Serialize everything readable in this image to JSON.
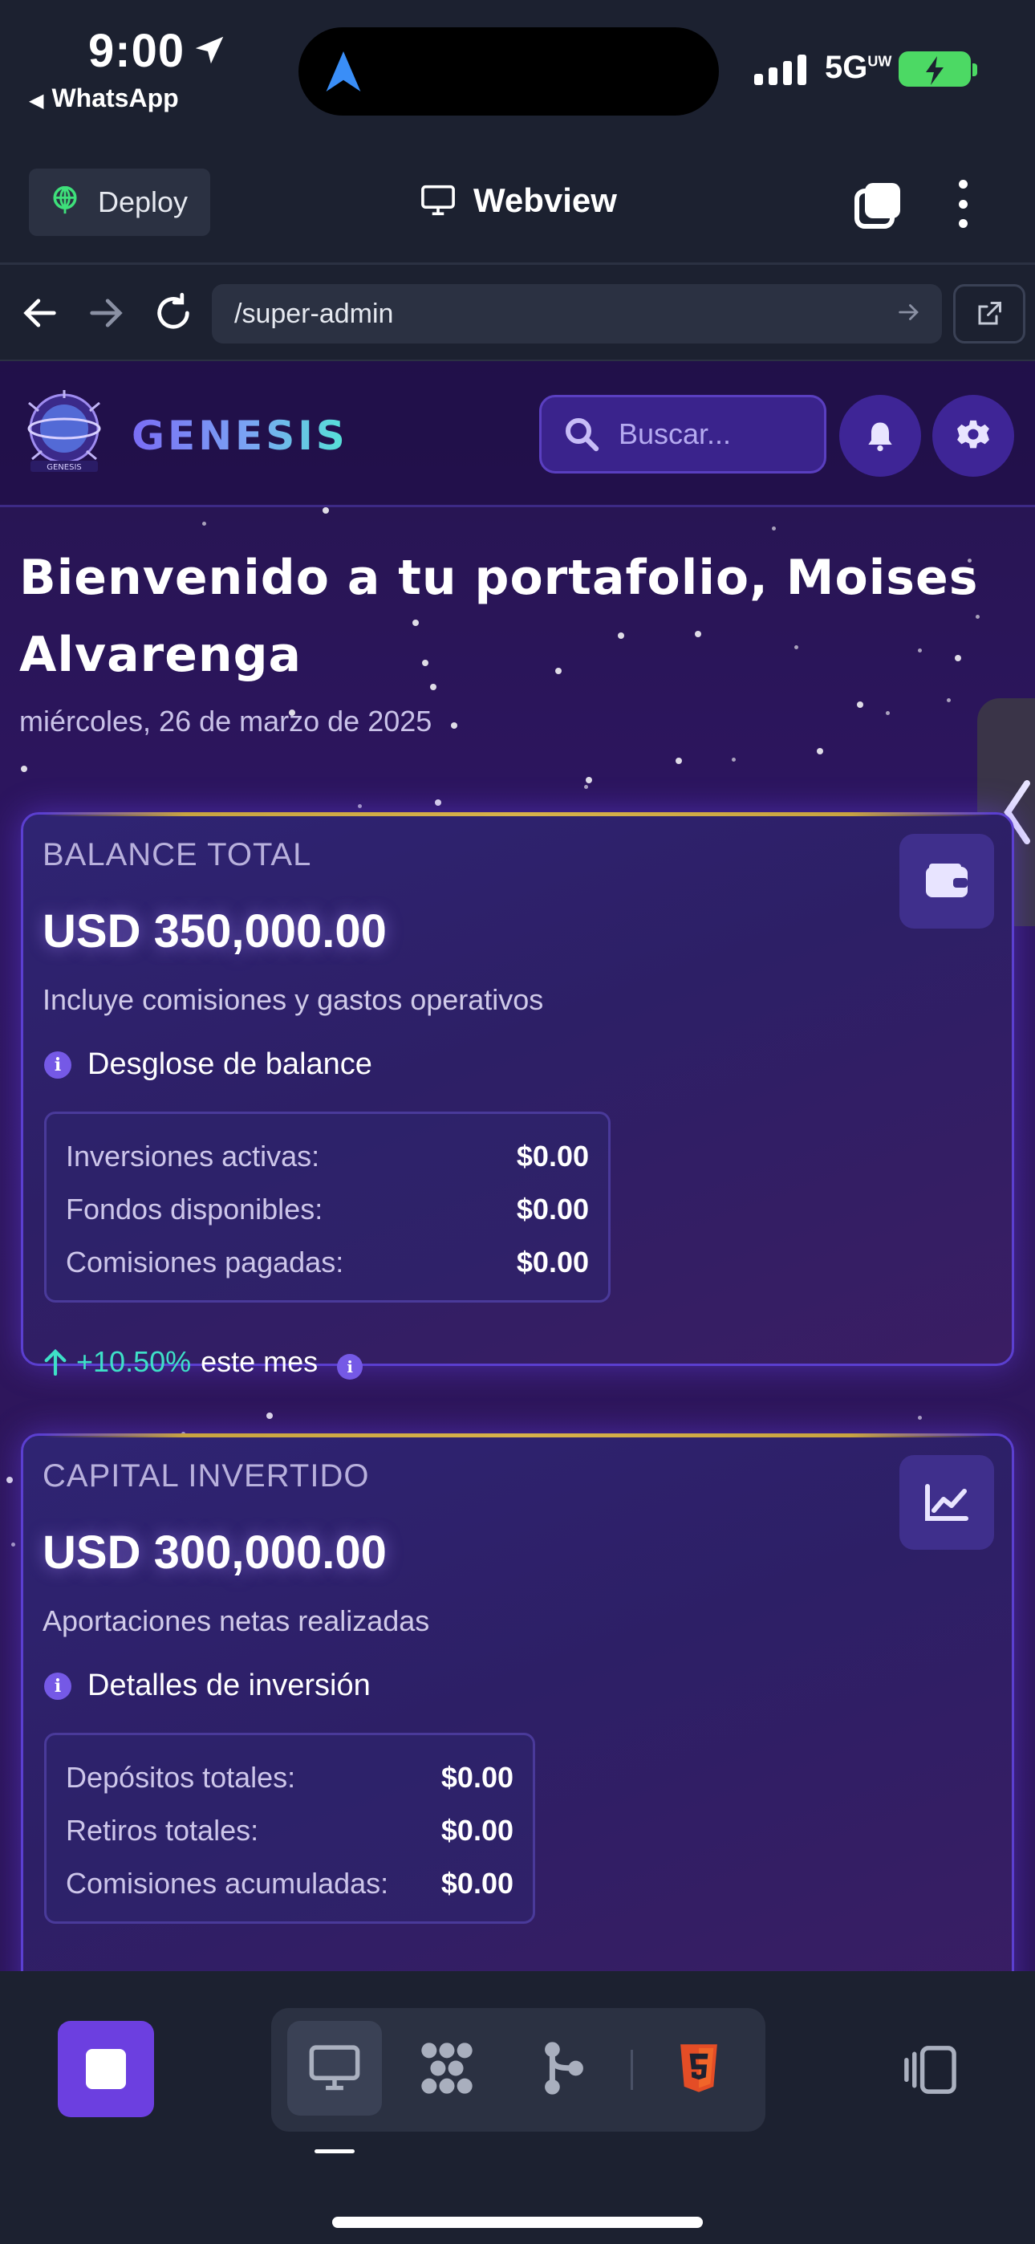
{
  "status_bar": {
    "time": "9:00",
    "back_app": "WhatsApp",
    "network": "5G",
    "network_sup": "UW"
  },
  "toolbar": {
    "deploy_label": "Deploy",
    "title": "Webview"
  },
  "url_bar": {
    "path": "/super-admin"
  },
  "app": {
    "brand": "GENESIS",
    "logo_text": "GENESIS",
    "search_placeholder": "Buscar...",
    "welcome": "Bienvenido a tu portafolio, Moises Alvarenga",
    "date": "miércoles, 26 de marzo de 2025"
  },
  "cards": [
    {
      "label": "BALANCE TOTAL",
      "value": "USD 350,000.00",
      "subtitle": "Incluye comisiones y gastos operativos",
      "info_label": "Desglose de balance",
      "icon": "wallet-icon",
      "rows": [
        {
          "label": "Inversiones activas:",
          "value": "$0.00"
        },
        {
          "label": "Fondos disponibles:",
          "value": "$0.00"
        },
        {
          "label": "Comisiones pagadas:",
          "value": "$0.00"
        }
      ],
      "growth_pct": "+10.50%",
      "growth_text": "este mes"
    },
    {
      "label": "CAPITAL INVERTIDO",
      "value": "USD 300,000.00",
      "subtitle": "Aportaciones netas realizadas",
      "info_label": "Detalles de inversión",
      "icon": "chart-line-icon",
      "rows": [
        {
          "label": "Depósitos totales:",
          "value": "$0.00"
        },
        {
          "label": "Retiros totales:",
          "value": "$0.00"
        },
        {
          "label": "Comisiones acumuladas:",
          "value": "$0.00"
        }
      ]
    }
  ],
  "colors": {
    "accent_purple": "#6c3fe0",
    "growth_teal": "#3ee0c7",
    "card_top_gold": "#d8b24a",
    "html5_orange": "#e44d26"
  }
}
